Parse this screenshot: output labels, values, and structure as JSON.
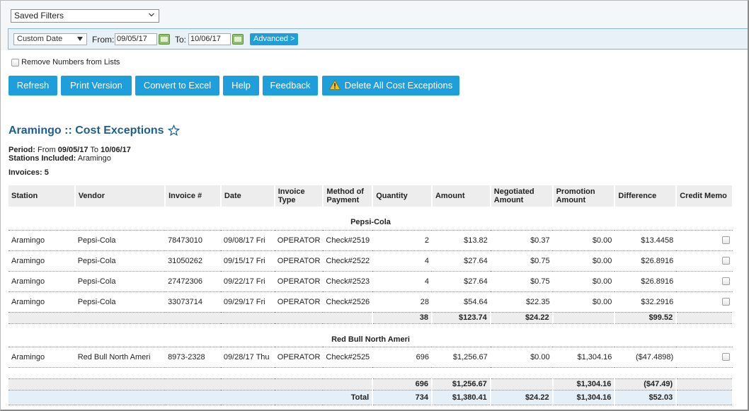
{
  "filters": {
    "saved_filters": "Saved Filters",
    "date_mode": "Custom Date",
    "from_label": "From:",
    "from_value": "09/05/17",
    "to_label": "To:",
    "to_value": "10/06/17",
    "advanced_label": "Advanced >"
  },
  "options": {
    "remove_numbers_label": "Remove Numbers from Lists"
  },
  "toolbar": {
    "refresh": "Refresh",
    "print_version": "Print Version",
    "convert_excel": "Convert to Excel",
    "help": "Help",
    "feedback": "Feedback",
    "delete_all": "Delete All Cost Exceptions"
  },
  "report": {
    "title": "Aramingo :: Cost Exceptions",
    "period_label": "Period:",
    "period_from_text": "From",
    "period_from": "09/05/17",
    "period_to_text": "To",
    "period_to": "10/06/17",
    "stations_label": "Stations Included:",
    "stations_value": "Aramingo",
    "invoices_label": "Invoices:",
    "invoices_count": "5"
  },
  "table": {
    "headers": {
      "station": "Station",
      "vendor": "Vendor",
      "invoice_no": "Invoice #",
      "date": "Date",
      "invoice_type": "Invoice Type",
      "method": "Method of Payment",
      "quantity": "Quantity",
      "amount": "Amount",
      "negotiated": "Negotiated Amount",
      "promotion": "Promotion Amount",
      "difference": "Difference",
      "credit_memo": "Credit Memo"
    },
    "groups": [
      {
        "name": "Pepsi-Cola",
        "rows": [
          {
            "station": "Aramingo",
            "vendor": "Pepsi-Cola",
            "invoice": "78473010",
            "date": "09/08/17 Fri",
            "type": "OPERATOR",
            "method": "Check#2519",
            "qty": "2",
            "amount": "$13.82",
            "negotiated": "$0.37",
            "promotion": "$0.00",
            "difference": "$13.4458"
          },
          {
            "station": "Aramingo",
            "vendor": "Pepsi-Cola",
            "invoice": "31050262",
            "date": "09/15/17 Fri",
            "type": "OPERATOR",
            "method": "Check#2522",
            "qty": "4",
            "amount": "$27.64",
            "negotiated": "$0.75",
            "promotion": "$0.00",
            "difference": "$26.8916"
          },
          {
            "station": "Aramingo",
            "vendor": "Pepsi-Cola",
            "invoice": "27472306",
            "date": "09/22/17 Fri",
            "type": "OPERATOR",
            "method": "Check#2523",
            "qty": "4",
            "amount": "$27.64",
            "negotiated": "$0.75",
            "promotion": "$0.00",
            "difference": "$26.8916"
          },
          {
            "station": "Aramingo",
            "vendor": "Pepsi-Cola",
            "invoice": "33073714",
            "date": "09/29/17 Fri",
            "type": "OPERATOR",
            "method": "Check#2526",
            "qty": "28",
            "amount": "$54.64",
            "negotiated": "$22.35",
            "promotion": "$0.00",
            "difference": "$32.2916"
          }
        ],
        "subtotal": {
          "qty": "38",
          "amount": "$123.74",
          "negotiated": "$24.22",
          "promotion": "",
          "difference": "$99.52"
        }
      },
      {
        "name": "Red Bull North Ameri",
        "rows": [
          {
            "station": "Aramingo",
            "vendor": "Red Bull North Ameri",
            "invoice": "8973-2328",
            "date": "09/28/17 Thu",
            "type": "OPERATOR",
            "method": "Check#2525",
            "qty": "696",
            "amount": "$1,256.67",
            "negotiated": "$0.00",
            "promotion": "$1,304.16",
            "difference": "($47.4898)"
          }
        ],
        "subtotal": {
          "qty": "696",
          "amount": "$1,256.67",
          "negotiated": "",
          "promotion": "$1,304.16",
          "difference": "($47.49)"
        }
      }
    ],
    "total": {
      "label": "Total",
      "qty": "734",
      "amount": "$1,380.41",
      "negotiated": "$24.22",
      "promotion": "$1,304.16",
      "difference": "$52.03"
    }
  }
}
